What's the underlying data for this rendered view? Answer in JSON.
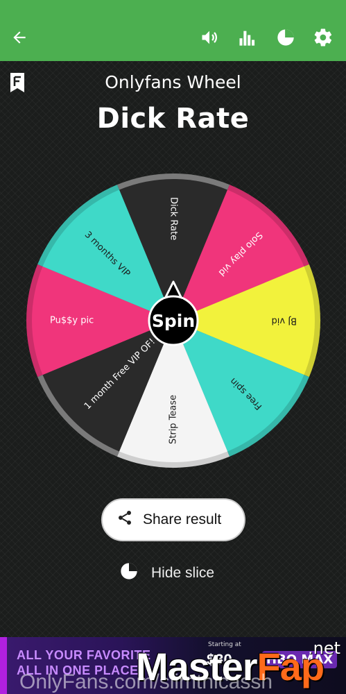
{
  "topbar": {
    "background": "#4caf50",
    "back_icon": "back-arrow-icon",
    "sound_icon": "volume-icon",
    "stats_icon": "bar-chart-icon",
    "pie_icon": "pie-chart-icon",
    "settings_icon": "gear-icon"
  },
  "header": {
    "bookmark_icon": "bookmark-icon",
    "app_subtitle": "Onlyfans Wheel",
    "wheel_title": "Dick Rate"
  },
  "wheel": {
    "center_label": "Spin",
    "slices": [
      {
        "label": "Dick Rate",
        "color": "#2a2a2a",
        "text_color": "#ffffff"
      },
      {
        "label": "Solo play vid",
        "color": "#f0357b",
        "text_color": "#ffffff"
      },
      {
        "label": "BJ vid",
        "color": "#f2f23c",
        "text_color": "#1a1a1a"
      },
      {
        "label": "Free spin",
        "color": "#3fd9c8",
        "text_color": "#1a1a1a"
      },
      {
        "label": "Strip Tease",
        "color": "#f4f4f4",
        "text_color": "#1a1a1a"
      },
      {
        "label": "1 month Free VIP OF!",
        "color": "#2a2a2a",
        "text_color": "#ffffff"
      },
      {
        "label": "Pu$$y pic",
        "color": "#f0357b",
        "text_color": "#ffffff"
      },
      {
        "label": "3 months VIP",
        "color": "#3fd9c8",
        "text_color": "#1a1a1a"
      }
    ]
  },
  "actions": {
    "share_label": "Share result",
    "share_icon": "share-icon",
    "hide_label": "Hide slice",
    "hide_icon": "pie-chart-icon"
  },
  "ad": {
    "line1": "ALL YOUR FAVORITE",
    "line2": "ALL IN ONE PLACE",
    "starting": "Starting at",
    "brand": "$30",
    "badge": "HBO MAX"
  },
  "watermark": {
    "main_a": "Master",
    "main_b": "Fap",
    "net": ".net",
    "bottom": "OnlyFans.com/slimthicassh"
  }
}
